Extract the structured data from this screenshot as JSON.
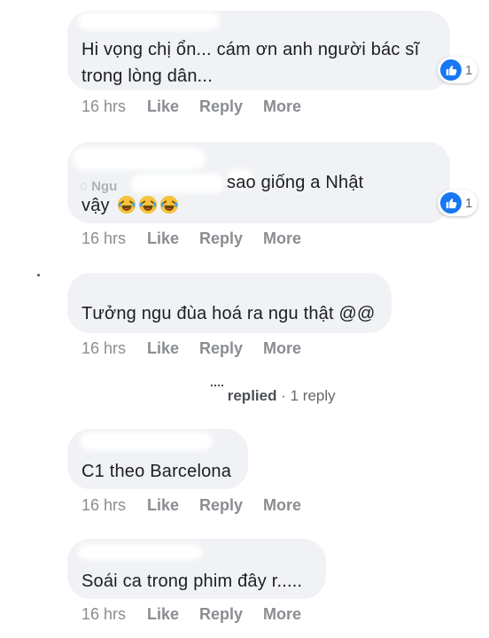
{
  "comments": [
    {
      "text_line1": "Hi vọng chị ổn... cám ơn anh người bác sĩ",
      "text_line2": "trong lòng dân...",
      "reaction_count": "1",
      "time": "16 hrs"
    },
    {
      "text_line1": "sao giống a Nhật",
      "text_line2": "vậy",
      "reaction_count": "1",
      "time": "16 hrs"
    },
    {
      "text_line1": "Tưởng ngu đùa hoá ra ngu thật @@",
      "time": "16 hrs"
    },
    {
      "text_line1": "C1 theo Barcelona",
      "time": "16 hrs"
    },
    {
      "text_line1": "Soái ca trong phim đây r.....",
      "time": "16 hrs"
    }
  ],
  "actions": {
    "like": "Like",
    "reply": "Reply",
    "more": "More"
  },
  "replies": {
    "replied_label": "replied",
    "separator": "·",
    "count_label": "1 reply"
  },
  "colors": {
    "bubble_bg": "#f0f2f5",
    "meta_text": "#8a8d91",
    "like_blue": "#1877f2",
    "laugh_yellow": "#f7c33d"
  },
  "icons": {
    "reaction": "like-thumb-icon",
    "emoji": "laughing-face-icon"
  }
}
